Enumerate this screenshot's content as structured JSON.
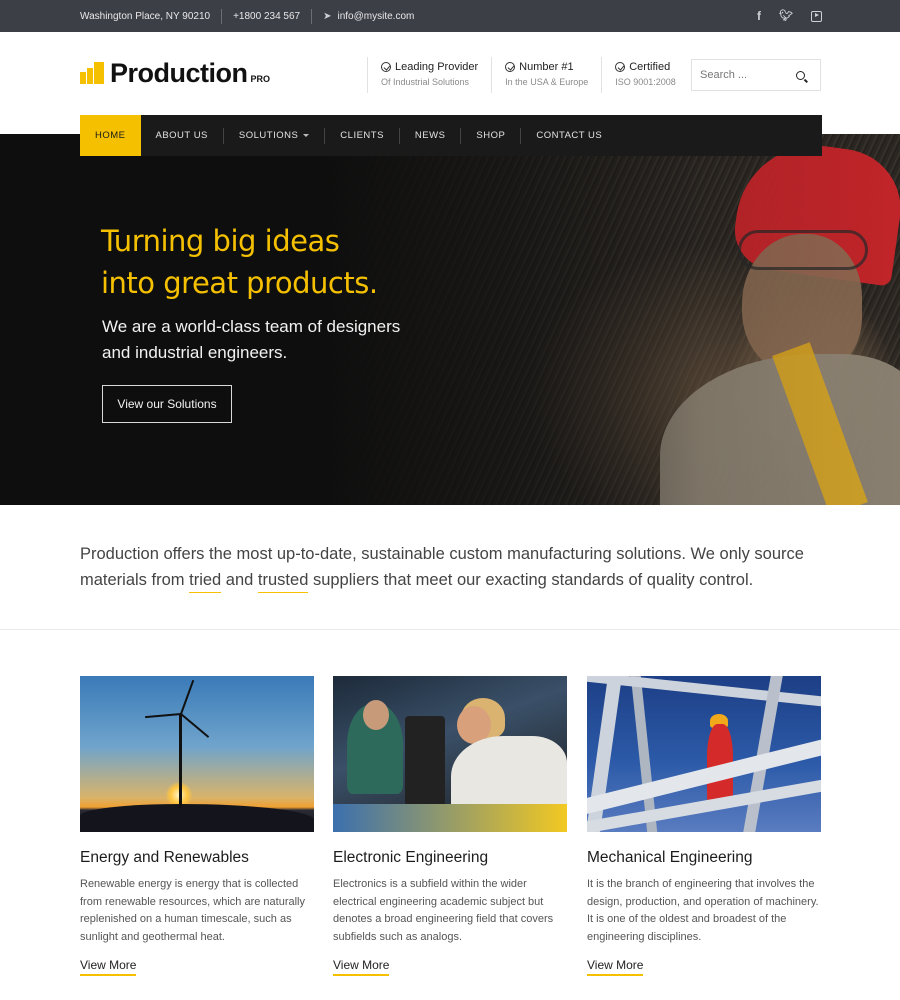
{
  "topbar": {
    "address": "Washington Place, NY 90210",
    "phone": "+1800 234 567",
    "email": "info@mysite.com",
    "social": [
      "facebook-icon",
      "twitter-icon",
      "youtube-icon"
    ]
  },
  "brand": {
    "name": "Production",
    "badge": "PRO",
    "accent_color": "#f5c000"
  },
  "features": [
    {
      "title": "Leading Provider",
      "subtitle": "Of Industrial Solutions"
    },
    {
      "title": "Number #1",
      "subtitle": "In the USA & Europe"
    },
    {
      "title": "Certified",
      "subtitle": "ISO 9001:2008"
    }
  ],
  "search": {
    "placeholder": "Search ..."
  },
  "nav": {
    "items": [
      {
        "label": "HOME",
        "active": true
      },
      {
        "label": "ABOUT US"
      },
      {
        "label": "SOLUTIONS",
        "has_dropdown": true
      },
      {
        "label": "CLIENTS"
      },
      {
        "label": "NEWS"
      },
      {
        "label": "SHOP"
      },
      {
        "label": "CONTACT US"
      }
    ]
  },
  "hero": {
    "title_line1": "Turning big ideas",
    "title_line2": "into great products.",
    "subtitle_line1": "We are a world-class team of designers",
    "subtitle_line2": "and industrial engineers.",
    "button_label": "View our Solutions"
  },
  "intro": {
    "line1": "Production offers the most up-to-date, sustainable custom manufacturing solutions. We only source",
    "line2_prefix": "materials from ",
    "highlight1": "tried",
    "line2_mid": " and ",
    "highlight2": "trusted",
    "line2_suffix": " suppliers that meet our exacting standards of quality control."
  },
  "cards": [
    {
      "title": "Energy and Renewables",
      "text": "Renewable energy is energy that is collected from renewable resources, which are naturally replenished on a human timescale, such as sunlight and geothermal heat.",
      "link": "View More"
    },
    {
      "title": "Electronic Engineering",
      "text": "Electronics is a subfield within the wider electrical engineering academic subject but denotes a broad engineering field that covers subfields such as analogs.",
      "link": "View More"
    },
    {
      "title": "Mechanical Engineering",
      "text": "It is the branch of engineering that involves the design, production, and operation of machinery. It is one of the oldest and broadest of the engineering disciplines.",
      "link": "View More"
    }
  ]
}
